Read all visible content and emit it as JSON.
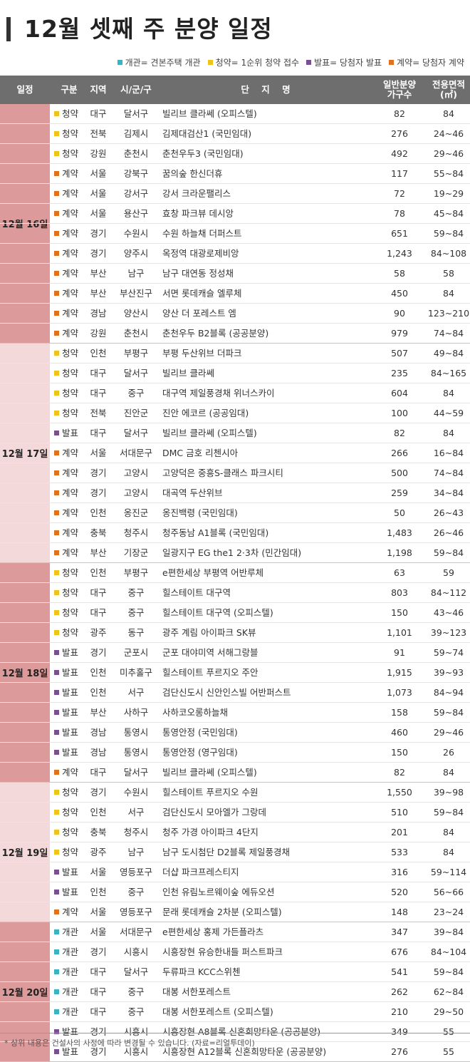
{
  "title": "12월 셋째 주 분양 일정",
  "legend": [
    {
      "label": "개관= 견본주택 개관",
      "color": "#39b3c3"
    },
    {
      "label": "청약= 1순위 청약 접수",
      "color": "#efc41a"
    },
    {
      "label": "발표= 당첨자 발표",
      "color": "#7a4f8f"
    },
    {
      "label": "계약= 당첨자 계약",
      "color": "#e0711f"
    }
  ],
  "type_colors": {
    "개관": "#39b3c3",
    "청약": "#efc41a",
    "발표": "#7a4f8f",
    "계약": "#e0711f"
  },
  "day_colors": [
    "#dc9a9a",
    "#f3d9d9"
  ],
  "columns": {
    "date": "일정",
    "type": "구분",
    "region": "지역",
    "city": "시/군/구",
    "name": "단    지    명",
    "units": "일반분양\n가구수",
    "area": "전용면적\n(㎡)"
  },
  "groups": [
    {
      "date": "12월 16일",
      "rows": [
        [
          "청약",
          "대구",
          "달서구",
          "빌리브 클라쎄 (오피스텔)",
          "82",
          "84"
        ],
        [
          "청약",
          "전북",
          "김제시",
          "김제대검산1 (국민임대)",
          "276",
          "24~46"
        ],
        [
          "청약",
          "강원",
          "춘천시",
          "춘천우두3 (국민임대)",
          "492",
          "29~46"
        ],
        [
          "계약",
          "서울",
          "강북구",
          "꿈의숲 한신더휴",
          "117",
          "55~84"
        ],
        [
          "계약",
          "서울",
          "강서구",
          "강서 크라운팰리스",
          "72",
          "19~29"
        ],
        [
          "계약",
          "서울",
          "용산구",
          "효창 파크뷰 데시앙",
          "78",
          "45~84"
        ],
        [
          "계약",
          "경기",
          "수원시",
          "수원 하늘채 더퍼스트",
          "651",
          "59~84"
        ],
        [
          "계약",
          "경기",
          "양주시",
          "옥정역 대광로제비앙",
          "1,243",
          "84~108"
        ],
        [
          "계약",
          "부산",
          "남구",
          "남구 대연동 정성채",
          "58",
          "58"
        ],
        [
          "계약",
          "부산",
          "부산진구",
          "서면 롯데캐슬 엘루체",
          "450",
          "84"
        ],
        [
          "계약",
          "경남",
          "양산시",
          "양산 더 포레스트 엠",
          "90",
          "123~210"
        ],
        [
          "계약",
          "강원",
          "춘천시",
          "춘천우두 B2블록 (공공분양)",
          "979",
          "74~84"
        ]
      ]
    },
    {
      "date": "12월 17일",
      "rows": [
        [
          "청약",
          "인천",
          "부평구",
          "부평 두산위브 더파크",
          "507",
          "49~84"
        ],
        [
          "청약",
          "대구",
          "달서구",
          "빌리브 클라쎄",
          "235",
          "84~165"
        ],
        [
          "청약",
          "대구",
          "중구",
          "대구역 제일풍경채 위너스카이",
          "604",
          "84"
        ],
        [
          "청약",
          "전북",
          "진안군",
          "진안 에코르 (공공임대)",
          "100",
          "44~59"
        ],
        [
          "발표",
          "대구",
          "달서구",
          "빌리브 클라쎄 (오피스텔)",
          "82",
          "84"
        ],
        [
          "계약",
          "서울",
          "서대문구",
          "DMC 금호 리첸시아",
          "266",
          "16~84"
        ],
        [
          "계약",
          "경기",
          "고양시",
          "고양덕은 중흥S-클래스 파크시티",
          "500",
          "74~84"
        ],
        [
          "계약",
          "경기",
          "고양시",
          "대곡역 두산위브",
          "259",
          "34~84"
        ],
        [
          "계약",
          "인천",
          "옹진군",
          "옹진백령 (국민임대)",
          "50",
          "26~43"
        ],
        [
          "계약",
          "충북",
          "청주시",
          "청주동남 A1블록 (국민임대)",
          "1,483",
          "26~46"
        ],
        [
          "계약",
          "부산",
          "기장군",
          "일광지구 EG the1 2·3차 (민간임대)",
          "1,198",
          "59~84"
        ]
      ]
    },
    {
      "date": "12월 18일",
      "rows": [
        [
          "청약",
          "인천",
          "부평구",
          "e편한세상 부평역 어반루체",
          "63",
          "59"
        ],
        [
          "청약",
          "대구",
          "중구",
          "힐스테이트 대구역",
          "803",
          "84~112"
        ],
        [
          "청약",
          "대구",
          "중구",
          "힐스테이트 대구역 (오피스텔)",
          "150",
          "43~46"
        ],
        [
          "청약",
          "광주",
          "동구",
          "광주 계림 아이파크 SK뷰",
          "1,101",
          "39~123"
        ],
        [
          "발표",
          "경기",
          "군포시",
          "군포 대야미역 서해그랑블",
          "91",
          "59~74"
        ],
        [
          "발표",
          "인천",
          "미추홀구",
          "힐스테이트 푸르지오 주안",
          "1,915",
          "39~93"
        ],
        [
          "발표",
          "인천",
          "서구",
          "검단신도시 신안인스빌 어반퍼스트",
          "1,073",
          "84~94"
        ],
        [
          "발표",
          "부산",
          "사하구",
          "사하코오롱하늘채",
          "158",
          "59~84"
        ],
        [
          "발표",
          "경남",
          "통영시",
          "통영안정 (국민임대)",
          "460",
          "29~46"
        ],
        [
          "발표",
          "경남",
          "통영시",
          "통영안정 (영구임대)",
          "150",
          "26"
        ],
        [
          "계약",
          "대구",
          "달서구",
          "빌리브 클라쎄 (오피스텔)",
          "82",
          "84"
        ]
      ]
    },
    {
      "date": "12월 19일",
      "rows": [
        [
          "청약",
          "경기",
          "수원시",
          "힐스테이트 푸르지오 수원",
          "1,550",
          "39~98"
        ],
        [
          "청약",
          "인천",
          "서구",
          "검단신도시 모아엘가 그랑데",
          "510",
          "59~84"
        ],
        [
          "청약",
          "충북",
          "청주시",
          "청주 가경 아이파크 4단지",
          "201",
          "84"
        ],
        [
          "청약",
          "광주",
          "남구",
          "남구 도시첨단 D2블록 제일풍경채",
          "533",
          "84"
        ],
        [
          "발표",
          "서울",
          "영등포구",
          "더샵 파크프레스티지",
          "316",
          "59~114"
        ],
        [
          "발표",
          "인천",
          "중구",
          "인천 유림노르웨이숲 에듀오션",
          "520",
          "56~66"
        ],
        [
          "계약",
          "서울",
          "영등포구",
          "문래 롯데캐슬 2차분 (오피스텔)",
          "148",
          "23~24"
        ]
      ]
    },
    {
      "date": "12월 20일",
      "rows": [
        [
          "개관",
          "서울",
          "서대문구",
          "e편한세상 홍제 가든플라츠",
          "347",
          "39~84"
        ],
        [
          "개관",
          "경기",
          "시흥시",
          "시흥장현 유승한내들 퍼스트파크",
          "676",
          "84~104"
        ],
        [
          "개관",
          "대구",
          "달서구",
          "두류파크 KCC스위첸",
          "541",
          "59~84"
        ],
        [
          "개관",
          "대구",
          "중구",
          "대봉 서한포레스트",
          "262",
          "62~84"
        ],
        [
          "개관",
          "대구",
          "중구",
          "대봉 서한포레스트 (오피스텔)",
          "210",
          "29~50"
        ],
        [
          "발표",
          "경기",
          "시흥시",
          "시흥장현 A8블록 신혼희망타운 (공공분양)",
          "349",
          "55"
        ],
        [
          "발표",
          "경기",
          "시흥시",
          "시흥장현 A12블록 신혼희망타운 (공공분양)",
          "276",
          "55"
        ]
      ]
    }
  ],
  "footer": "* 상위 내용은 건설사의 사정에 따라 변경될 수 있습니다. (자료=리얼투데이)"
}
